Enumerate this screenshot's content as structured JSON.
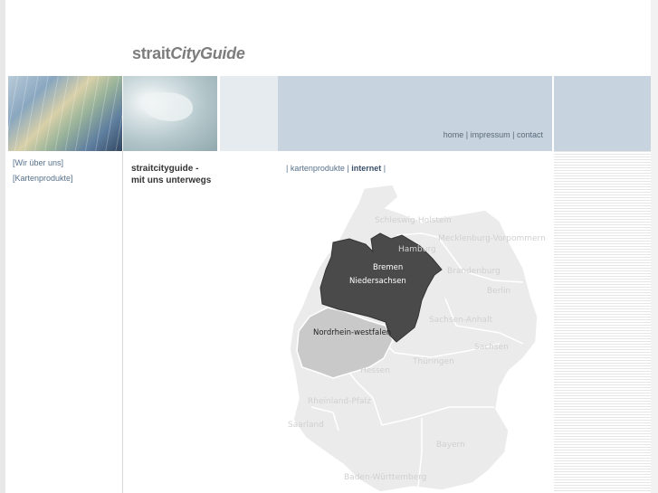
{
  "logo": {
    "part_a": "strait",
    "part_b": "CityGuide"
  },
  "top_links": {
    "home": "home",
    "impressum": "impressum",
    "contact": "contact",
    "separator": "|"
  },
  "sidebar": {
    "items": [
      {
        "label": "[Wir über uns]"
      },
      {
        "label": "[Kartenprodukte]"
      }
    ]
  },
  "tagline": {
    "line1": "straitcityguide -",
    "line2": "mit uns unterwegs"
  },
  "tabs": {
    "lead": "| ",
    "kartenprodukte": "kartenprodukte",
    "mid": " | ",
    "internet": "internet",
    "trail": " |"
  },
  "map": {
    "regions": [
      "Schleswig-Holstein",
      "Hamburg",
      "Mecklenburg-Vorpommern",
      "Bremen",
      "Niedersachsen",
      "Brandenburg",
      "Berlin",
      "Sachsen-Anhalt",
      "Nordrhein-westfalen",
      "Sachsen",
      "Thüringen",
      "Hessen",
      "Rheinland-Pfalz",
      "Saarland",
      "Bayern",
      "Baden-Württemberg"
    ],
    "colors": {
      "highlight_dark": "#4a4a4a",
      "highlight_mid": "#c9c9c9",
      "base": "#ebebeb"
    }
  },
  "colors": {
    "header_blue": "#c7d3de",
    "link": "#56708a",
    "logo": "#7d7d7d"
  }
}
